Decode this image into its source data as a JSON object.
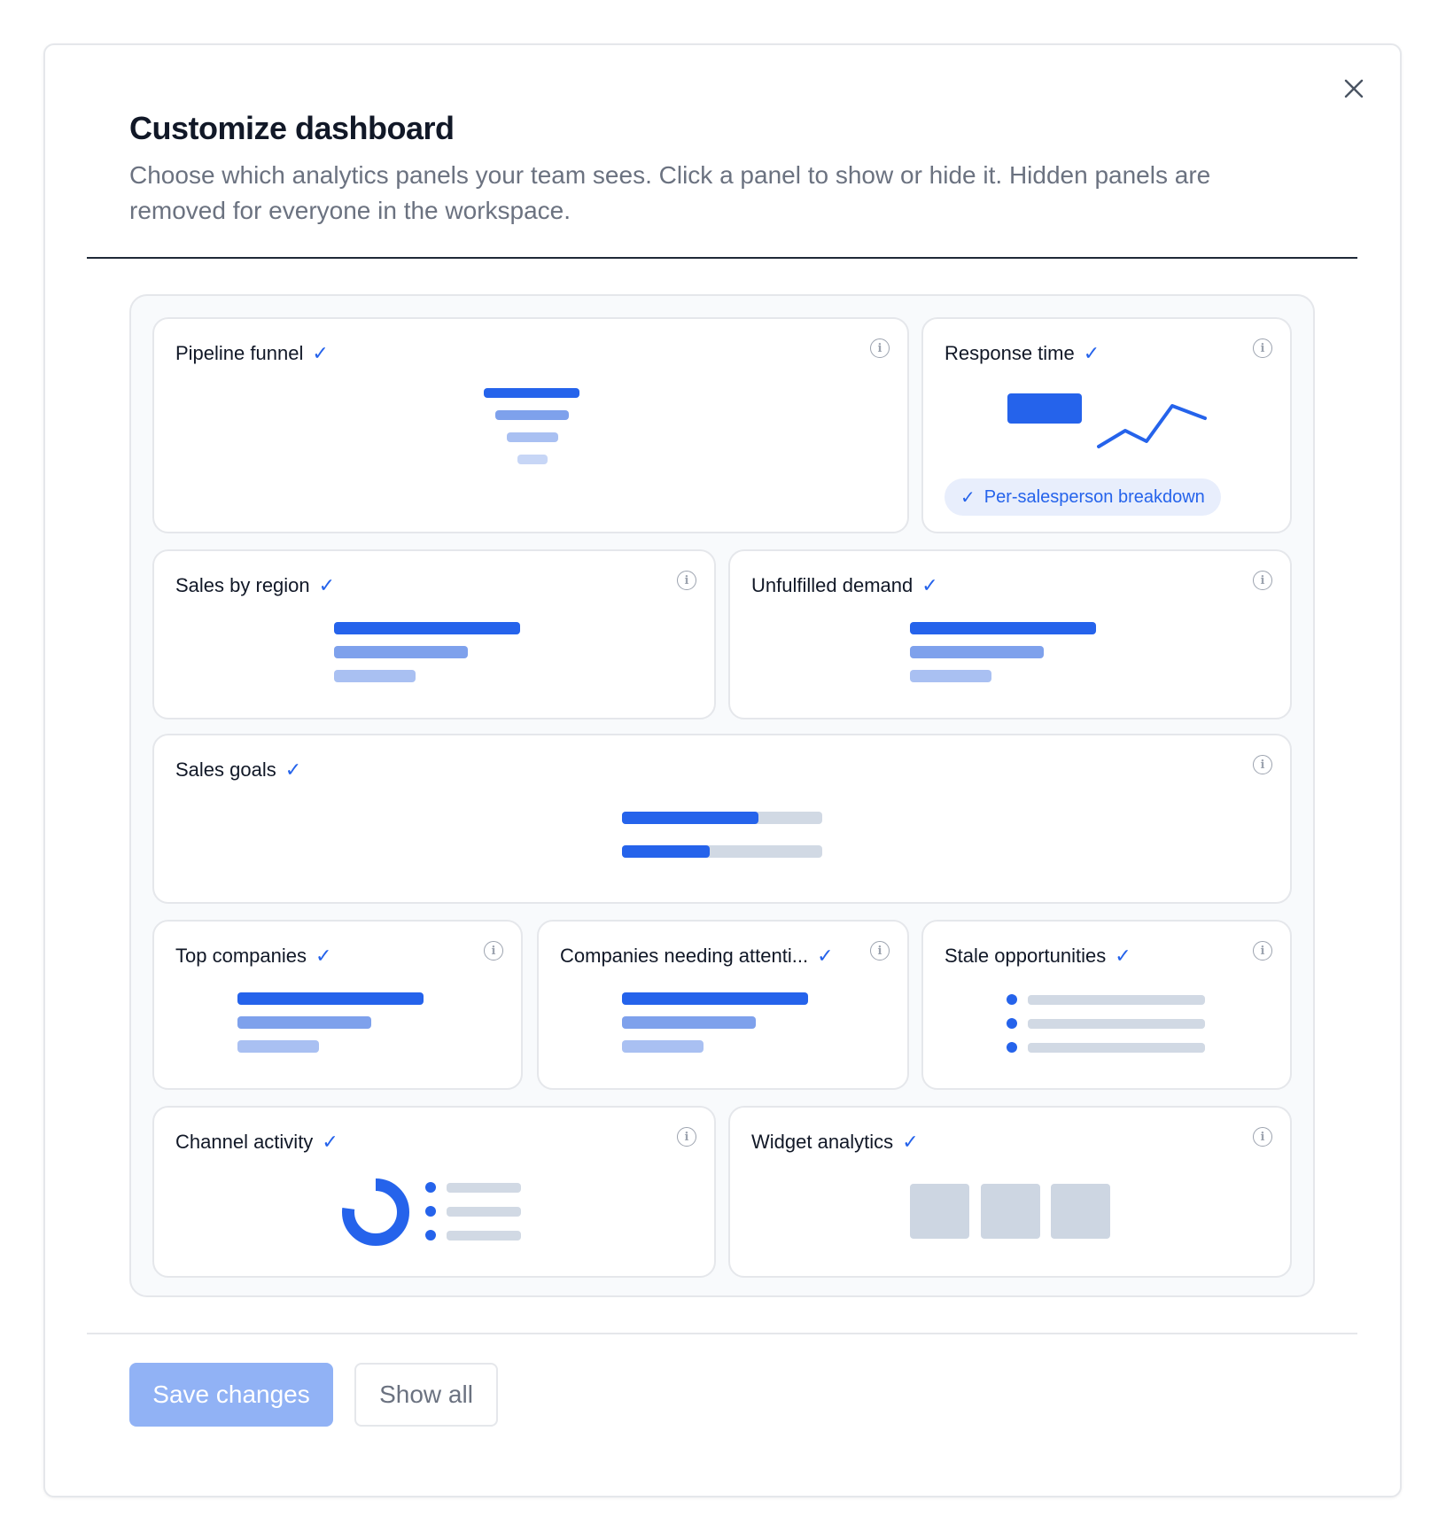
{
  "dialog": {
    "title": "Customize dashboard",
    "description": "Choose which analytics panels your team sees. Click a panel to show or hide it. Hidden panels are removed for everyone in the workspace.",
    "close_icon": "close-icon"
  },
  "panels": {
    "pipeline_funnel": {
      "label": "Pipeline funnel",
      "checked": true
    },
    "response_time": {
      "label": "Response time",
      "checked": true,
      "option_label": "Per-salesperson breakdown"
    },
    "sales_by_region": {
      "label": "Sales by region",
      "checked": true
    },
    "unfulfilled_demand": {
      "label": "Unfulfilled demand",
      "checked": true
    },
    "sales_goals": {
      "label": "Sales goals",
      "checked": true,
      "goal_progress": [
        0.68,
        0.44
      ]
    },
    "top_companies": {
      "label": "Top companies",
      "checked": true
    },
    "companies_attention": {
      "label": "Companies needing attenti...",
      "checked": true
    },
    "stale_opportunities": {
      "label": "Stale opportunities",
      "checked": true
    },
    "channel_activity": {
      "label": "Channel activity",
      "checked": true
    },
    "widget_analytics": {
      "label": "Widget analytics",
      "checked": true
    }
  },
  "footer": {
    "save_label": "Save changes",
    "show_all_label": "Show all"
  },
  "colors": {
    "accent": "#2563eb",
    "save_disabled": "#91b2f5"
  }
}
